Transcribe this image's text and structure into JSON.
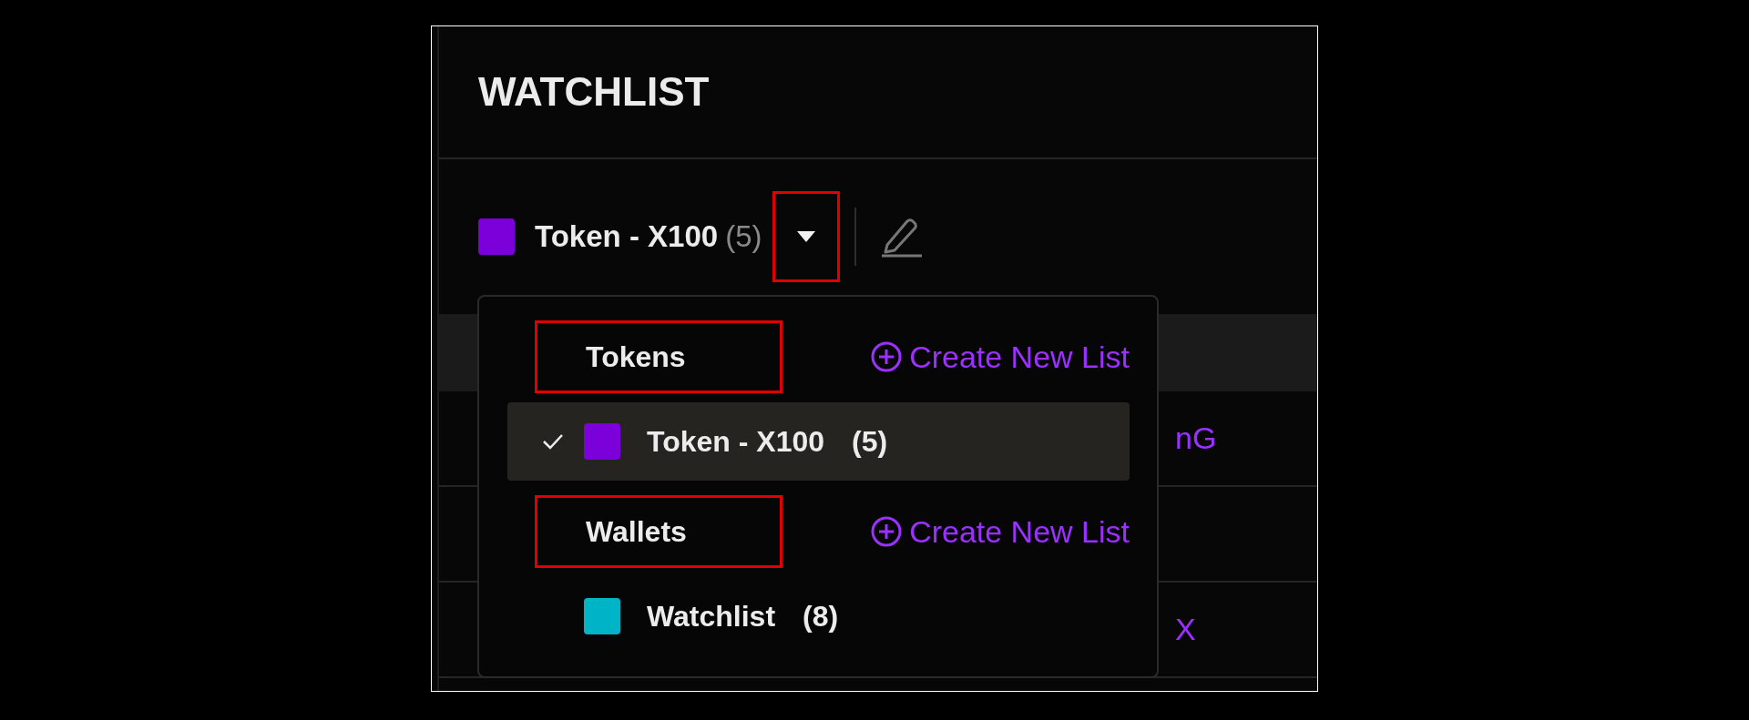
{
  "title": "WATCHLIST",
  "selector": {
    "name": "Token - X100",
    "count": "(5)",
    "color": "#7b00d9",
    "caret_highlighted": true
  },
  "table": {
    "rows": [
      {
        "column_2": "nG"
      },
      {},
      {
        "column_2": "X"
      }
    ]
  },
  "menu": {
    "groups": [
      {
        "label": "Tokens",
        "highlighted": true,
        "action": "Create New List",
        "items": [
          {
            "name": "Token - X100",
            "count": "(5)",
            "color": "#7b00d9",
            "selected": true
          }
        ]
      },
      {
        "label": "Wallets",
        "highlighted": true,
        "action": "Create New List",
        "items": [
          {
            "name": "Watchlist",
            "count": "(8)",
            "color": "#00b4c8",
            "selected": false
          }
        ]
      }
    ]
  }
}
